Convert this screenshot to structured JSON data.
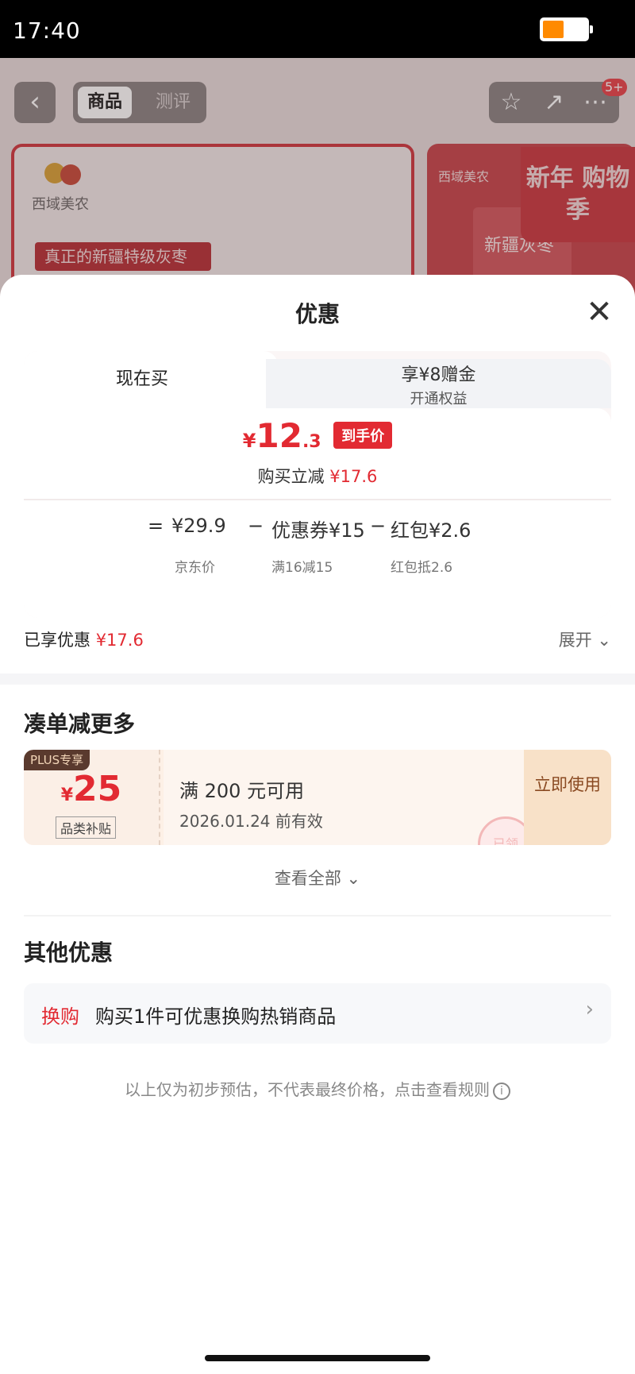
{
  "status": {
    "time": "17:40"
  },
  "background": {
    "tabs": [
      "商品",
      "测评"
    ],
    "badge": "5+",
    "brand": "西域美农",
    "ribbon": "真正的新疆特级灰枣",
    "promo": "新年 购物季",
    "box_text": "新疆灰枣"
  },
  "sheet": {
    "title": "优惠",
    "tab_now": "现在买",
    "tab_plus_line1": "享¥8赠金",
    "tab_plus_line2": "开通权益",
    "price_currency": "¥",
    "price_int": "12",
    "price_dec": ".3",
    "price_tag": "到手价",
    "saved_label": "购买立减",
    "saved_value": "¥17.6",
    "formula": {
      "eq": "=",
      "jd_price": "¥29.9",
      "minus1": "−",
      "coupon": "优惠券¥15",
      "minus2": "−",
      "redpack": "红包¥2.6",
      "jd_label": "京东价",
      "coupon_label": "满16减15",
      "redpack_label": "红包抵2.6"
    },
    "enjoyed_label": "已享优惠",
    "enjoyed_value": "¥17.6",
    "expand": "展开 ⌄"
  },
  "more": {
    "title": "凑单减更多",
    "coupon": {
      "plus_tag": "PLUS专享",
      "currency": "¥",
      "value": "25",
      "category": "品类补贴",
      "condition": "满 200 元可用",
      "expiry": "2026.01.24 前有效",
      "action": "立即使用",
      "stamp": "已领"
    },
    "see_all": "查看全部 ⌄"
  },
  "other": {
    "title": "其他优惠",
    "swap_label": "换购",
    "swap_text": "购买1件可优惠换购热销商品"
  },
  "footnote": "以上仅为初步预估，不代表最终价格，点击查看规则",
  "colors": {
    "accent": "#e22a32",
    "bg": "#ffffff"
  }
}
